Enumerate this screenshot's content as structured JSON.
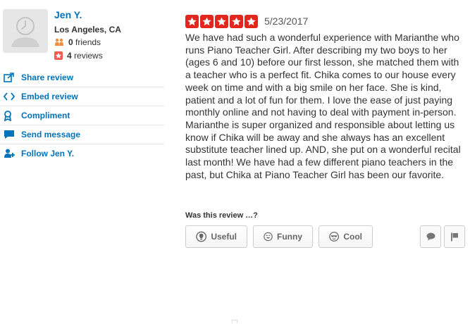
{
  "user": {
    "name": "Jen Y.",
    "location": "Los Angeles, CA",
    "friends_count": "0",
    "friends_label": "friends",
    "reviews_count": "4",
    "reviews_label": "reviews"
  },
  "actions": {
    "share": "Share review",
    "embed": "Embed review",
    "compliment": "Compliment",
    "send_message": "Send message",
    "follow": "Follow Jen Y."
  },
  "review": {
    "rating": 5,
    "rating_max": 5,
    "date": "5/23/2017",
    "text": "We have had such a wonderful experience with Marianthe who runs Piano Teacher Girl. After describing my two boys to her  (ages 6 and 10) before our first lesson, she matched them with a teacher who is a perfect fit. Chika comes to our house every week on time and with a big smile on her face. She is kind, patient and a lot of fun for them. I love the ease of just paying monthly online and not having to deal with payment in-person. Marianthe is super organized and responsible about letting us know if Chika will be away and she always has an excellent substitute teacher lined up. AND, she put on a wonderful recital last month! We have had a few different piano teachers in the past, but Chika at Piano Teacher Girl has been our favorite."
  },
  "votes": {
    "prompt": "Was this review …?",
    "useful": "Useful",
    "funny": "Funny",
    "cool": "Cool"
  },
  "colors": {
    "link": "#0073bb",
    "star": "#e2271e",
    "reviews_badge": "#f15c4f"
  }
}
